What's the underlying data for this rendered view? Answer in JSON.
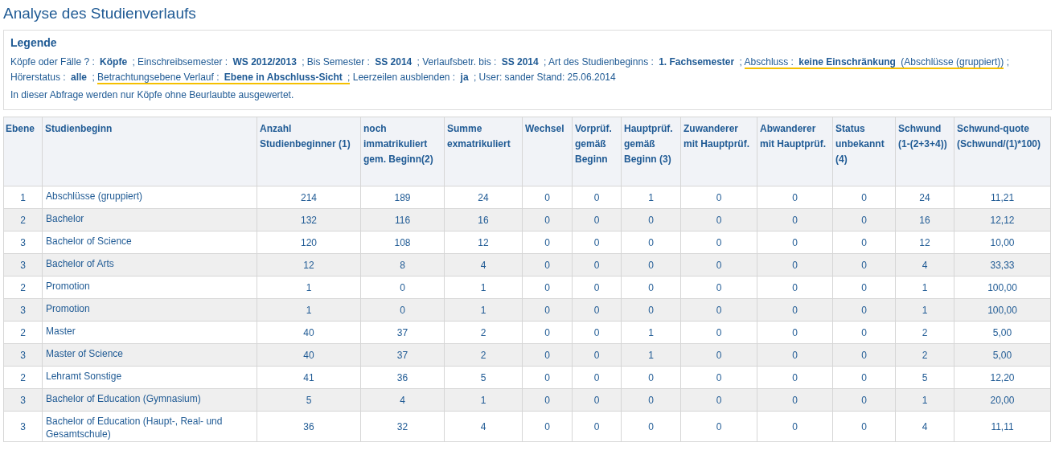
{
  "title": "Analyse des Studienverlaufs",
  "legend": {
    "heading": "Legende",
    "segments": [
      {
        "text": "Köpfe oder Fälle ? : ",
        "bold": false,
        "highlighted": false
      },
      {
        "text": "Köpfe",
        "bold": true,
        "highlighted": false
      },
      {
        "text": " ; Einschreibsemester : ",
        "bold": false,
        "highlighted": false
      },
      {
        "text": "WS 2012/2013",
        "bold": true,
        "highlighted": false
      },
      {
        "text": " ; Bis Semester : ",
        "bold": false,
        "highlighted": false
      },
      {
        "text": "SS 2014",
        "bold": true,
        "highlighted": false
      },
      {
        "text": " ; Verlaufsbetr. bis : ",
        "bold": false,
        "highlighted": false
      },
      {
        "text": "SS 2014",
        "bold": true,
        "highlighted": false
      },
      {
        "text": " ; Art des Studienbeginns : ",
        "bold": false,
        "highlighted": false
      },
      {
        "text": "1. Fachsemester",
        "bold": true,
        "highlighted": false
      },
      {
        "text": " ; ",
        "bold": false,
        "highlighted": false
      },
      {
        "text": "Abschluss : ",
        "bold": false,
        "highlighted": true
      },
      {
        "text": "keine Einschränkung",
        "bold": true,
        "highlighted": true
      },
      {
        "text": " (Abschlüsse (gruppiert))",
        "bold": false,
        "highlighted": true
      },
      {
        "text": " ; Hörerstatus : ",
        "bold": false,
        "highlighted": false
      },
      {
        "text": "alle",
        "bold": true,
        "highlighted": false
      },
      {
        "text": " ; ",
        "bold": false,
        "highlighted": false
      },
      {
        "text": "Betrachtungsebene Verlauf : ",
        "bold": false,
        "highlighted": true
      },
      {
        "text": "Ebene in Abschluss-Sicht",
        "bold": true,
        "highlighted": true
      },
      {
        "text": " ;",
        "bold": false,
        "highlighted": true
      },
      {
        "text": " Leerzeilen ausblenden : ",
        "bold": false,
        "highlighted": false
      },
      {
        "text": "ja",
        "bold": true,
        "highlighted": false
      },
      {
        "text": " ; User: sander   Stand: 25.06.2014",
        "bold": false,
        "highlighted": false
      }
    ],
    "note": "In dieser Abfrage werden nur Köpfe ohne Beurlaubte ausgewertet."
  },
  "table": {
    "columns": [
      "Ebene",
      "Studienbeginn",
      "Anzahl Studienbeginner (1)",
      "noch immatrikuliert gem. Beginn(2)",
      "Summe exmatrikuliert",
      "Wechsel",
      "Vorprüf. gemäß Beginn",
      "Hauptprüf. gemäß Beginn (3)",
      "Zuwanderer mit Hauptprüf.",
      "Abwanderer mit Hauptprüf.",
      "Status unbekannt (4)",
      "Schwund (1-(2+3+4))",
      "Schwund-quote (Schwund/(1)*100)"
    ],
    "rows": [
      [
        "1",
        "Abschlüsse (gruppiert)",
        "214",
        "189",
        "24",
        "0",
        "0",
        "1",
        "0",
        "0",
        "0",
        "24",
        "11,21"
      ],
      [
        "2",
        "Bachelor",
        "132",
        "116",
        "16",
        "0",
        "0",
        "0",
        "0",
        "0",
        "0",
        "16",
        "12,12"
      ],
      [
        "3",
        "Bachelor of Science",
        "120",
        "108",
        "12",
        "0",
        "0",
        "0",
        "0",
        "0",
        "0",
        "12",
        "10,00"
      ],
      [
        "3",
        "Bachelor of Arts",
        "12",
        "8",
        "4",
        "0",
        "0",
        "0",
        "0",
        "0",
        "0",
        "4",
        "33,33"
      ],
      [
        "2",
        "Promotion",
        "1",
        "0",
        "1",
        "0",
        "0",
        "0",
        "0",
        "0",
        "0",
        "1",
        "100,00"
      ],
      [
        "3",
        "Promotion",
        "1",
        "0",
        "1",
        "0",
        "0",
        "0",
        "0",
        "0",
        "0",
        "1",
        "100,00"
      ],
      [
        "2",
        "Master",
        "40",
        "37",
        "2",
        "0",
        "0",
        "1",
        "0",
        "0",
        "0",
        "2",
        "5,00"
      ],
      [
        "3",
        "Master of Science",
        "40",
        "37",
        "2",
        "0",
        "0",
        "1",
        "0",
        "0",
        "0",
        "2",
        "5,00"
      ],
      [
        "2",
        "Lehramt Sonstige",
        "41",
        "36",
        "5",
        "0",
        "0",
        "0",
        "0",
        "0",
        "0",
        "5",
        "12,20"
      ],
      [
        "3",
        "Bachelor of Education (Gymnasium)",
        "5",
        "4",
        "1",
        "0",
        "0",
        "0",
        "0",
        "0",
        "0",
        "1",
        "20,00"
      ],
      [
        "3",
        "Bachelor of Education (Haupt-, Real- und Gesamtschule)",
        "36",
        "32",
        "4",
        "0",
        "0",
        "0",
        "0",
        "0",
        "0",
        "4",
        "11,11"
      ]
    ]
  }
}
